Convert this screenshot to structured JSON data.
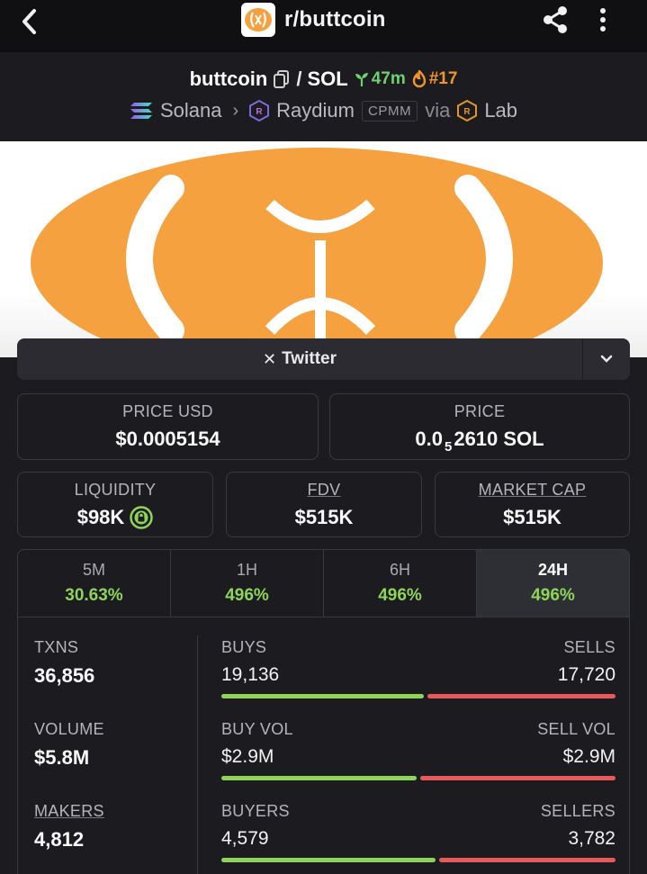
{
  "header": {
    "title": "r/buttcoin"
  },
  "pair": {
    "base": "buttcoin",
    "separator": "/",
    "quote": "SOL",
    "age": "47m",
    "rank": "#17",
    "chain": "Solana",
    "dex": "Raydium",
    "pool_type": "CPMM",
    "via_label": "via",
    "launchpad": "Lab"
  },
  "links": {
    "twitter_label": "Twitter"
  },
  "prices": {
    "usd_label": "PRICE USD",
    "usd_value": "$0.0005154",
    "native_label": "PRICE",
    "native_prefix": "0.0",
    "native_zeros": "5",
    "native_digits": "2610 SOL"
  },
  "metrics": {
    "liquidity_label": "LIQUIDITY",
    "liquidity_value": "$98K",
    "fdv_label": "FDV",
    "fdv_value": "$515K",
    "mcap_label": "MARKET CAP",
    "mcap_value": "$515K"
  },
  "timeframes": [
    {
      "label": "5M",
      "value": "30.63%"
    },
    {
      "label": "1H",
      "value": "496%"
    },
    {
      "label": "6H",
      "value": "496%"
    },
    {
      "label": "24H",
      "value": "496%"
    }
  ],
  "stats": {
    "txns_label": "TXNS",
    "txns_value": "36,856",
    "volume_label": "VOLUME",
    "volume_value": "$5.8M",
    "makers_label": "MAKERS",
    "makers_value": "4,812",
    "buys_label": "BUYS",
    "buys_value": "19,136",
    "sells_label": "SELLS",
    "sells_value": "17,720",
    "buy_fraction": 0.519,
    "buyvol_label": "BUY VOL",
    "buyvol_value": "$2.9M",
    "sellvol_label": "SELL VOL",
    "sellvol_value": "$2.9M",
    "buyvol_fraction": 0.5,
    "buyers_label": "BUYERS",
    "buyers_value": "4,579",
    "sellers_label": "SELLERS",
    "sellers_value": "3,782",
    "buyers_fraction": 0.548
  },
  "colors": {
    "accent_green": "#8fd45a",
    "sell_red": "#e85a5a",
    "brand_orange": "#f6a13f"
  }
}
